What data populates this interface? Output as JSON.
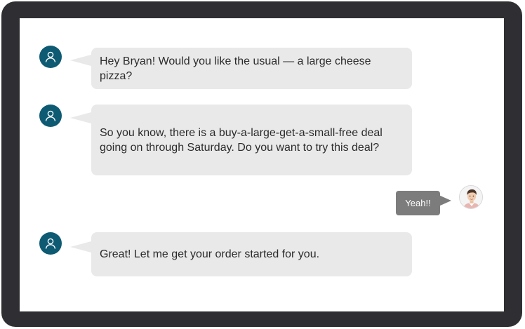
{
  "colors": {
    "frame": "#2f2f33",
    "screen": "#ffffff",
    "bot_avatar": "#0e5a73",
    "bot_bubble": "#e9e9e9",
    "user_bubble": "#7c7c7c",
    "user_text": "#ffffff"
  },
  "conversation": {
    "messages": [
      {
        "sender": "bot",
        "avatar_icon": "person-icon",
        "text": "Hey Bryan! Would you like the usual — a large cheese pizza?"
      },
      {
        "sender": "bot",
        "avatar_icon": "person-icon",
        "text": "So you know, there is a buy-a-large-get-a-small-free deal going on through Saturday. Do you want to try this deal?"
      },
      {
        "sender": "user",
        "avatar_icon": "user-photo",
        "text": "Yeah!!"
      },
      {
        "sender": "bot",
        "avatar_icon": "person-icon",
        "text": "Great! Let me get your order started for you."
      }
    ]
  }
}
